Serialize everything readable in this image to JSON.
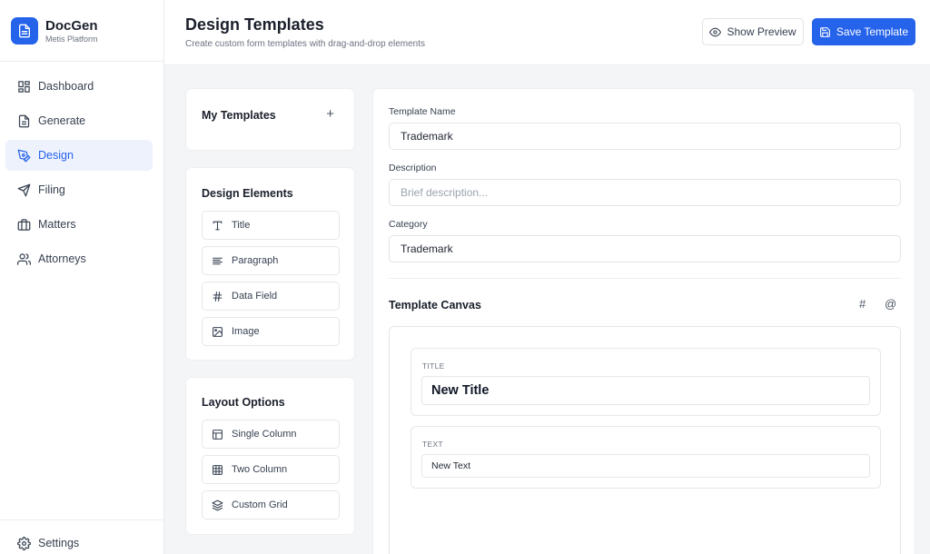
{
  "brand": {
    "name": "DocGen",
    "subtitle": "Metis Platform",
    "icon": "document-icon"
  },
  "sidebar": {
    "items": [
      {
        "label": "Dashboard",
        "icon": "dashboard-icon",
        "active": false
      },
      {
        "label": "Generate",
        "icon": "file-text-icon",
        "active": false
      },
      {
        "label": "Design",
        "icon": "pen-tool-icon",
        "active": true
      },
      {
        "label": "Filing",
        "icon": "send-icon",
        "active": false
      },
      {
        "label": "Matters",
        "icon": "briefcase-icon",
        "active": false
      },
      {
        "label": "Attorneys",
        "icon": "users-icon",
        "active": false
      }
    ],
    "footer": {
      "label": "Settings",
      "icon": "gear-icon"
    }
  },
  "header": {
    "title": "Design Templates",
    "subtitle": "Create custom form templates with drag-and-drop elements",
    "preview_label": "Show Preview",
    "save_label": "Save Template"
  },
  "templates_card": {
    "title": "My Templates",
    "add_icon": "plus-icon"
  },
  "design_elements": {
    "title": "Design Elements",
    "items": [
      {
        "label": "Title",
        "icon": "type-icon"
      },
      {
        "label": "Paragraph",
        "icon": "align-left-icon"
      },
      {
        "label": "Data Field",
        "icon": "hash-icon"
      },
      {
        "label": "Image",
        "icon": "image-icon"
      }
    ]
  },
  "layout_options": {
    "title": "Layout Options",
    "items": [
      {
        "label": "Single Column",
        "icon": "layout-icon"
      },
      {
        "label": "Two Column",
        "icon": "grid-icon"
      },
      {
        "label": "Custom Grid",
        "icon": "layers-icon"
      }
    ]
  },
  "form": {
    "name_label": "Template Name",
    "name_value": "Trademark",
    "description_label": "Description",
    "description_placeholder": "Brief description...",
    "category_label": "Category",
    "category_value": "Trademark"
  },
  "canvas": {
    "title": "Template Canvas",
    "tools": [
      "#",
      "@"
    ],
    "blocks": [
      {
        "label": "TITLE",
        "value": "New Title"
      },
      {
        "label": "TEXT",
        "value": "New Text"
      }
    ]
  },
  "colors": {
    "accent": "#2563eb",
    "active_bg": "#eef2fd"
  }
}
